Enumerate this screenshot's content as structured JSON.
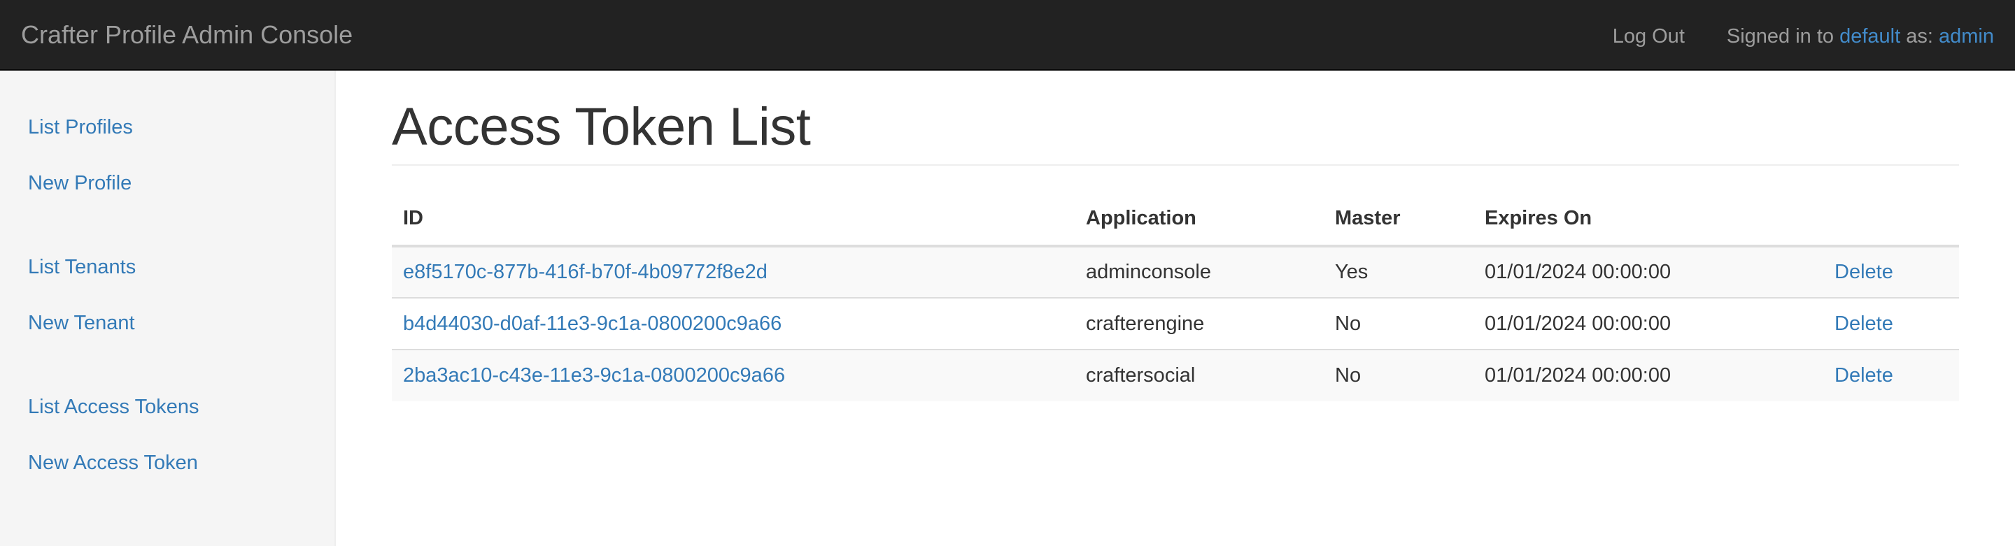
{
  "navbar": {
    "brand": "Crafter Profile Admin Console",
    "logout_label": "Log Out",
    "signed_in_prefix": "Signed in to ",
    "tenant": "default",
    "signed_in_middle": " as: ",
    "username": "admin"
  },
  "sidebar": {
    "items": [
      {
        "label": "List Profiles"
      },
      {
        "label": "New Profile"
      },
      {
        "label": "List Tenants"
      },
      {
        "label": "New Tenant"
      },
      {
        "label": "List Access Tokens"
      },
      {
        "label": "New Access Token"
      }
    ]
  },
  "main": {
    "title": "Access Token List",
    "table": {
      "headers": [
        "ID",
        "Application",
        "Master",
        "Expires On",
        ""
      ],
      "rows": [
        {
          "id": "e8f5170c-877b-416f-b70f-4b09772f8e2d",
          "application": "adminconsole",
          "master": "Yes",
          "expires_on": "01/01/2024 00:00:00",
          "action": "Delete"
        },
        {
          "id": "b4d44030-d0af-11e3-9c1a-0800200c9a66",
          "application": "crafterengine",
          "master": "No",
          "expires_on": "01/01/2024 00:00:00",
          "action": "Delete"
        },
        {
          "id": "2ba3ac10-c43e-11e3-9c1a-0800200c9a66",
          "application": "craftersocial",
          "master": "No",
          "expires_on": "01/01/2024 00:00:00",
          "action": "Delete"
        }
      ]
    }
  },
  "colors": {
    "navbar_bg": "#222222",
    "navbar_text": "#9d9d9d",
    "link": "#337ab7",
    "navbar_link": "#428bca",
    "sidebar_bg": "#f5f5f5",
    "stripe": "#f9f9f9"
  }
}
